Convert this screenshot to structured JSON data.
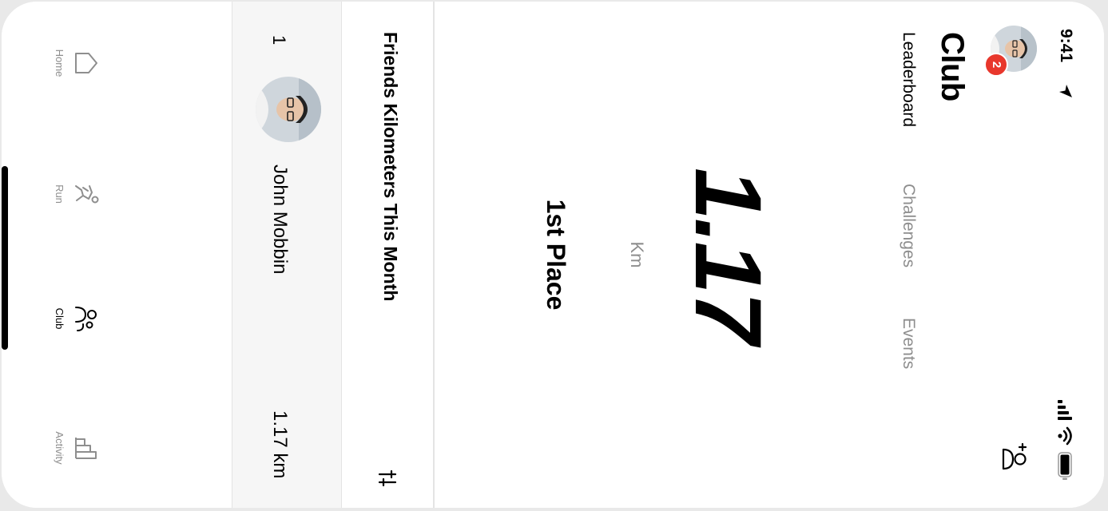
{
  "status_bar": {
    "time": "9:41"
  },
  "header": {
    "notification_count": "2",
    "title": "Club"
  },
  "tabs": [
    {
      "label": "Leaderboard",
      "active": true
    },
    {
      "label": "Challenges",
      "active": false
    },
    {
      "label": "Events",
      "active": false
    }
  ],
  "summary": {
    "distance": "1.17",
    "unit": "Km",
    "place": "1st Place"
  },
  "leaderboard": {
    "title": "Friends Kilometers This Month",
    "rows": [
      {
        "rank": "1",
        "name": "John Mobbin",
        "value": "1.17 km"
      }
    ]
  },
  "nav": {
    "items": [
      {
        "label": "Home",
        "icon": "home-icon",
        "active": false
      },
      {
        "label": "Run",
        "icon": "run-icon",
        "active": false
      },
      {
        "label": "Club",
        "icon": "club-icon",
        "active": true
      },
      {
        "label": "Activity",
        "icon": "activity-icon",
        "active": false
      }
    ]
  },
  "colors": {
    "badge": "#e8372c",
    "row_highlight": "#f6f6f6",
    "muted_text": "#8e8e8e"
  }
}
